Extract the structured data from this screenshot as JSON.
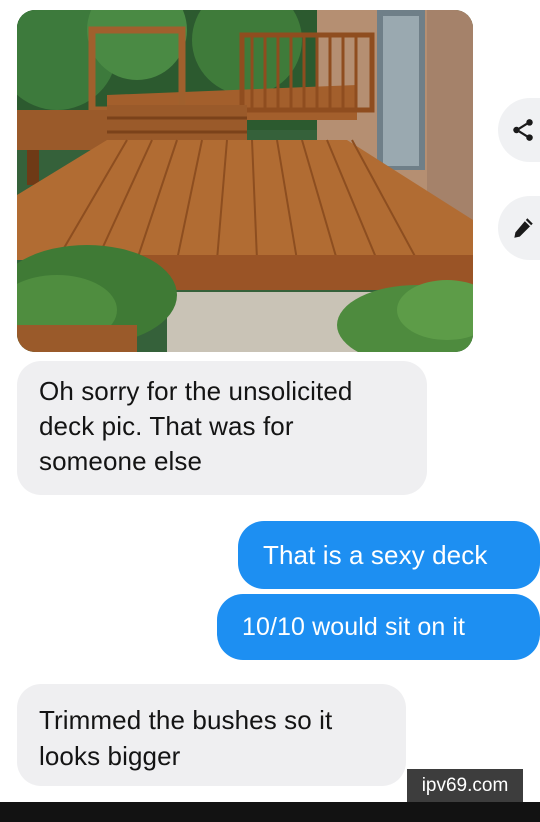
{
  "photo": {
    "icon": "deck-photo"
  },
  "actions": [
    {
      "icon": "share-icon"
    },
    {
      "icon": "edit-pencil-icon"
    }
  ],
  "messages": [
    {
      "side": "incoming",
      "lines": [
        "Oh sorry for the unsolicited",
        "deck pic. That was for",
        "someone else"
      ]
    },
    {
      "side": "outgoing",
      "text": "That is a sexy deck"
    },
    {
      "side": "outgoing",
      "text": "10/10 would sit on it"
    },
    {
      "side": "incoming",
      "lines": [
        "Trimmed the bushes so it",
        "looks bigger"
      ]
    }
  ],
  "colors": {
    "outgoing_bubble": "#1d8ff2",
    "incoming_bubble": "#efeff1"
  },
  "watermark": "ipv69.com"
}
